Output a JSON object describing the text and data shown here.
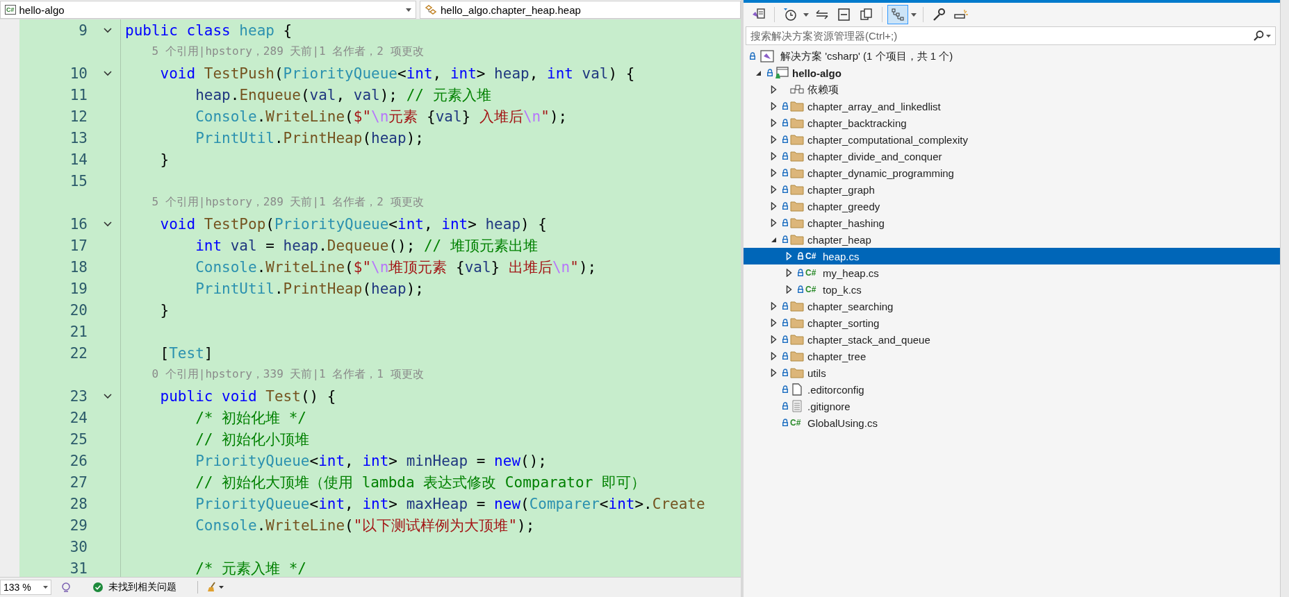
{
  "editor": {
    "file_dropdown": {
      "badge": "C#",
      "label": "hello-algo"
    },
    "member_dropdown": {
      "label": "hello_algo.chapter_heap.heap"
    },
    "lines": [
      {
        "kind": "code",
        "number": "9",
        "fold": true,
        "tokens": [
          {
            "kind": "keyword",
            "text": "public"
          },
          {
            "kind": "keyword",
            "text": " class"
          },
          {
            "kind": "type",
            "text": " heap"
          },
          {
            "kind": "plain",
            "text": " {"
          }
        ]
      },
      {
        "kind": "codelens",
        "text": "    5 个引用|hpstory，289 天前|1 名作者，2 项更改"
      },
      {
        "kind": "code",
        "number": "10",
        "fold": true,
        "tokens": [
          {
            "kind": "keyword",
            "text": "    void"
          },
          {
            "kind": "method",
            "text": " TestPush"
          },
          {
            "kind": "plain",
            "text": "("
          },
          {
            "kind": "type",
            "text": "PriorityQueue"
          },
          {
            "kind": "plain",
            "text": "<"
          },
          {
            "kind": "keyword",
            "text": "int"
          },
          {
            "kind": "plain",
            "text": ", "
          },
          {
            "kind": "keyword",
            "text": "int"
          },
          {
            "kind": "plain",
            "text": "> "
          },
          {
            "kind": "variable",
            "text": "heap"
          },
          {
            "kind": "plain",
            "text": ", "
          },
          {
            "kind": "keyword",
            "text": "int"
          },
          {
            "kind": "variable",
            "text": " val"
          },
          {
            "kind": "plain",
            "text": ") {"
          }
        ]
      },
      {
        "kind": "code",
        "number": "11",
        "fold": false,
        "tokens": [
          {
            "kind": "variable",
            "text": "        heap"
          },
          {
            "kind": "plain",
            "text": "."
          },
          {
            "kind": "method",
            "text": "Enqueue"
          },
          {
            "kind": "plain",
            "text": "("
          },
          {
            "kind": "variable",
            "text": "val"
          },
          {
            "kind": "plain",
            "text": ", "
          },
          {
            "kind": "variable",
            "text": "val"
          },
          {
            "kind": "plain",
            "text": "); "
          },
          {
            "kind": "comment",
            "text": "// 元素入堆"
          }
        ]
      },
      {
        "kind": "code",
        "number": "12",
        "fold": false,
        "tokens": [
          {
            "kind": "type",
            "text": "        Console"
          },
          {
            "kind": "plain",
            "text": "."
          },
          {
            "kind": "method",
            "text": "WriteLine"
          },
          {
            "kind": "plain",
            "text": "("
          },
          {
            "kind": "string",
            "text": "$\""
          },
          {
            "kind": "escape",
            "text": "\\n"
          },
          {
            "kind": "string",
            "text": "元素 "
          },
          {
            "kind": "plain",
            "text": "{"
          },
          {
            "kind": "variable",
            "text": "val"
          },
          {
            "kind": "plain",
            "text": "}"
          },
          {
            "kind": "string",
            "text": " 入堆后"
          },
          {
            "kind": "escape",
            "text": "\\n"
          },
          {
            "kind": "string",
            "text": "\""
          },
          {
            "kind": "plain",
            "text": ");"
          }
        ]
      },
      {
        "kind": "code",
        "number": "13",
        "fold": false,
        "tokens": [
          {
            "kind": "type",
            "text": "        PrintUtil"
          },
          {
            "kind": "plain",
            "text": "."
          },
          {
            "kind": "method",
            "text": "PrintHeap"
          },
          {
            "kind": "plain",
            "text": "("
          },
          {
            "kind": "variable",
            "text": "heap"
          },
          {
            "kind": "plain",
            "text": ");"
          }
        ]
      },
      {
        "kind": "code",
        "number": "14",
        "fold": false,
        "tokens": [
          {
            "kind": "plain",
            "text": "    }"
          }
        ]
      },
      {
        "kind": "code",
        "number": "15",
        "fold": false
      },
      {
        "kind": "codelens",
        "text": "    5 个引用|hpstory，289 天前|1 名作者，2 项更改"
      },
      {
        "kind": "code",
        "number": "16",
        "fold": true,
        "tokens": [
          {
            "kind": "keyword",
            "text": "    void"
          },
          {
            "kind": "method",
            "text": " TestPop"
          },
          {
            "kind": "plain",
            "text": "("
          },
          {
            "kind": "type",
            "text": "PriorityQueue"
          },
          {
            "kind": "plain",
            "text": "<"
          },
          {
            "kind": "keyword",
            "text": "int"
          },
          {
            "kind": "plain",
            "text": ", "
          },
          {
            "kind": "keyword",
            "text": "int"
          },
          {
            "kind": "plain",
            "text": "> "
          },
          {
            "kind": "variable",
            "text": "heap"
          },
          {
            "kind": "plain",
            "text": ") {"
          }
        ]
      },
      {
        "kind": "code",
        "number": "17",
        "fold": false,
        "tokens": [
          {
            "kind": "keyword",
            "text": "        int"
          },
          {
            "kind": "variable",
            "text": " val"
          },
          {
            "kind": "plain",
            "text": " = "
          },
          {
            "kind": "variable",
            "text": "heap"
          },
          {
            "kind": "plain",
            "text": "."
          },
          {
            "kind": "method",
            "text": "Dequeue"
          },
          {
            "kind": "plain",
            "text": "(); "
          },
          {
            "kind": "comment",
            "text": "// 堆顶元素出堆"
          }
        ]
      },
      {
        "kind": "code",
        "number": "18",
        "fold": false,
        "tokens": [
          {
            "kind": "type",
            "text": "        Console"
          },
          {
            "kind": "plain",
            "text": "."
          },
          {
            "kind": "method",
            "text": "WriteLine"
          },
          {
            "kind": "plain",
            "text": "("
          },
          {
            "kind": "string",
            "text": "$\""
          },
          {
            "kind": "escape",
            "text": "\\n"
          },
          {
            "kind": "string",
            "text": "堆顶元素 "
          },
          {
            "kind": "plain",
            "text": "{"
          },
          {
            "kind": "variable",
            "text": "val"
          },
          {
            "kind": "plain",
            "text": "}"
          },
          {
            "kind": "string",
            "text": " 出堆后"
          },
          {
            "kind": "escape",
            "text": "\\n"
          },
          {
            "kind": "string",
            "text": "\""
          },
          {
            "kind": "plain",
            "text": ");"
          }
        ]
      },
      {
        "kind": "code",
        "number": "19",
        "fold": false,
        "tokens": [
          {
            "kind": "type",
            "text": "        PrintUtil"
          },
          {
            "kind": "plain",
            "text": "."
          },
          {
            "kind": "method",
            "text": "PrintHeap"
          },
          {
            "kind": "plain",
            "text": "("
          },
          {
            "kind": "variable",
            "text": "heap"
          },
          {
            "kind": "plain",
            "text": ");"
          }
        ]
      },
      {
        "kind": "code",
        "number": "20",
        "fold": false,
        "tokens": [
          {
            "kind": "plain",
            "text": "    }"
          }
        ]
      },
      {
        "kind": "code",
        "number": "21",
        "fold": false
      },
      {
        "kind": "code",
        "number": "22",
        "fold": false,
        "tokens": [
          {
            "kind": "plain",
            "text": "    ["
          },
          {
            "kind": "type",
            "text": "Test"
          },
          {
            "kind": "plain",
            "text": "]"
          }
        ]
      },
      {
        "kind": "codelens",
        "text": "    0 个引用|hpstory，339 天前|1 名作者，1 项更改"
      },
      {
        "kind": "code",
        "number": "23",
        "fold": true,
        "tokens": [
          {
            "kind": "keyword",
            "text": "    public"
          },
          {
            "kind": "keyword",
            "text": " void"
          },
          {
            "kind": "method",
            "text": " Test"
          },
          {
            "kind": "plain",
            "text": "() {"
          }
        ]
      },
      {
        "kind": "code",
        "number": "24",
        "fold": false,
        "tokens": [
          {
            "kind": "comment",
            "text": "        /* 初始化堆 */"
          }
        ]
      },
      {
        "kind": "code",
        "number": "25",
        "fold": false,
        "tokens": [
          {
            "kind": "comment",
            "text": "        // 初始化小顶堆"
          }
        ]
      },
      {
        "kind": "code",
        "number": "26",
        "fold": false,
        "tokens": [
          {
            "kind": "type",
            "text": "        PriorityQueue"
          },
          {
            "kind": "plain",
            "text": "<"
          },
          {
            "kind": "keyword",
            "text": "int"
          },
          {
            "kind": "plain",
            "text": ", "
          },
          {
            "kind": "keyword",
            "text": "int"
          },
          {
            "kind": "plain",
            "text": "> "
          },
          {
            "kind": "variable",
            "text": "minHeap"
          },
          {
            "kind": "plain",
            "text": " = "
          },
          {
            "kind": "keyword",
            "text": "new"
          },
          {
            "kind": "plain",
            "text": "();"
          }
        ]
      },
      {
        "kind": "code",
        "number": "27",
        "fold": false,
        "tokens": [
          {
            "kind": "comment",
            "text": "        // 初始化大顶堆（使用 lambda 表达式修改 Comparator 即可）"
          }
        ]
      },
      {
        "kind": "code",
        "number": "28",
        "fold": false,
        "tokens": [
          {
            "kind": "type",
            "text": "        PriorityQueue"
          },
          {
            "kind": "plain",
            "text": "<"
          },
          {
            "kind": "keyword",
            "text": "int"
          },
          {
            "kind": "plain",
            "text": ", "
          },
          {
            "kind": "keyword",
            "text": "int"
          },
          {
            "kind": "plain",
            "text": "> "
          },
          {
            "kind": "variable",
            "text": "maxHeap"
          },
          {
            "kind": "plain",
            "text": " = "
          },
          {
            "kind": "keyword",
            "text": "new"
          },
          {
            "kind": "plain",
            "text": "("
          },
          {
            "kind": "type",
            "text": "Comparer"
          },
          {
            "kind": "plain",
            "text": "<"
          },
          {
            "kind": "keyword",
            "text": "int"
          },
          {
            "kind": "plain",
            "text": ">."
          },
          {
            "kind": "method",
            "text": "Create"
          }
        ]
      },
      {
        "kind": "code",
        "number": "29",
        "fold": false,
        "tokens": [
          {
            "kind": "type",
            "text": "        Console"
          },
          {
            "kind": "plain",
            "text": "."
          },
          {
            "kind": "method",
            "text": "WriteLine"
          },
          {
            "kind": "plain",
            "text": "("
          },
          {
            "kind": "string",
            "text": "\"以下测试样例为大顶堆\""
          },
          {
            "kind": "plain",
            "text": ");"
          }
        ]
      },
      {
        "kind": "code",
        "number": "30",
        "fold": false
      },
      {
        "kind": "code",
        "number": "31",
        "fold": false,
        "tokens": [
          {
            "kind": "comment",
            "text": "        /* 元素入堆 */"
          }
        ]
      }
    ]
  },
  "status_bar": {
    "zoom": "133 %",
    "issues": "未找到相关问题"
  },
  "solution_explorer": {
    "toolbar": [
      {
        "kind": "views",
        "pressed": false,
        "dropdown": false
      },
      {
        "kind": "history",
        "pressed": false,
        "dropdown": true
      },
      {
        "kind": "sync",
        "pressed": false,
        "dropdown": false
      },
      {
        "kind": "collapse",
        "pressed": false,
        "dropdown": false
      },
      {
        "kind": "show-all",
        "pressed": false,
        "dropdown": false
      },
      {
        "kind": "tree",
        "pressed": true,
        "dropdown": true
      },
      {
        "kind": "properties",
        "pressed": false,
        "dropdown": false
      },
      {
        "kind": "preview",
        "pressed": false,
        "dropdown": false
      }
    ],
    "search": {
      "placeholder": "搜索解决方案资源管理器(Ctrl+;)"
    },
    "solution": {
      "label": "解决方案 'csharp' (1 个项目，共 1 个)"
    },
    "tree": [
      {
        "label": "hello-algo",
        "kind": "project",
        "expandable": true,
        "expanded": true,
        "selected": false,
        "children": [
          {
            "label": "依赖项",
            "kind": "dependencies",
            "expandable": true,
            "expanded": false,
            "selected": false
          },
          {
            "label": "chapter_array_and_linkedlist",
            "kind": "folder",
            "expandable": true,
            "expanded": false,
            "selected": false
          },
          {
            "label": "chapter_backtracking",
            "kind": "folder",
            "expandable": true,
            "expanded": false,
            "selected": false
          },
          {
            "label": "chapter_computational_complexity",
            "kind": "folder",
            "expandable": true,
            "expanded": false,
            "selected": false
          },
          {
            "label": "chapter_divide_and_conquer",
            "kind": "folder",
            "expandable": true,
            "expanded": false,
            "selected": false
          },
          {
            "label": "chapter_dynamic_programming",
            "kind": "folder",
            "expandable": true,
            "expanded": false,
            "selected": false
          },
          {
            "label": "chapter_graph",
            "kind": "folder",
            "expandable": true,
            "expanded": false,
            "selected": false
          },
          {
            "label": "chapter_greedy",
            "kind": "folder",
            "expandable": true,
            "expanded": false,
            "selected": false
          },
          {
            "label": "chapter_hashing",
            "kind": "folder",
            "expandable": true,
            "expanded": false,
            "selected": false
          },
          {
            "label": "chapter_heap",
            "kind": "folder",
            "expandable": true,
            "expanded": true,
            "selected": false,
            "children": [
              {
                "label": "heap.cs",
                "kind": "csharp",
                "badge": "C#",
                "expandable": true,
                "expanded": false,
                "selected": true
              },
              {
                "label": "my_heap.cs",
                "kind": "csharp",
                "badge": "C#",
                "expandable": true,
                "expanded": false,
                "selected": false
              },
              {
                "label": "top_k.cs",
                "kind": "csharp",
                "badge": "C#",
                "expandable": true,
                "expanded": false,
                "selected": false
              }
            ]
          },
          {
            "label": "chapter_searching",
            "kind": "folder",
            "expandable": true,
            "expanded": false,
            "selected": false
          },
          {
            "label": "chapter_sorting",
            "kind": "folder",
            "expandable": true,
            "expanded": false,
            "selected": false
          },
          {
            "label": "chapter_stack_and_queue",
            "kind": "folder",
            "expandable": true,
            "expanded": false,
            "selected": false
          },
          {
            "label": "chapter_tree",
            "kind": "folder",
            "expandable": true,
            "expanded": false,
            "selected": false
          },
          {
            "label": "utils",
            "kind": "folder",
            "expandable": true,
            "expanded": false,
            "selected": false
          },
          {
            "label": ".editorconfig",
            "kind": "config",
            "expandable": false,
            "selected": false
          },
          {
            "label": ".gitignore",
            "kind": "text",
            "expandable": false,
            "selected": false
          },
          {
            "label": "GlobalUsing.cs",
            "kind": "csharp",
            "badge": "C#",
            "expandable": false,
            "selected": false
          }
        ]
      }
    ]
  }
}
